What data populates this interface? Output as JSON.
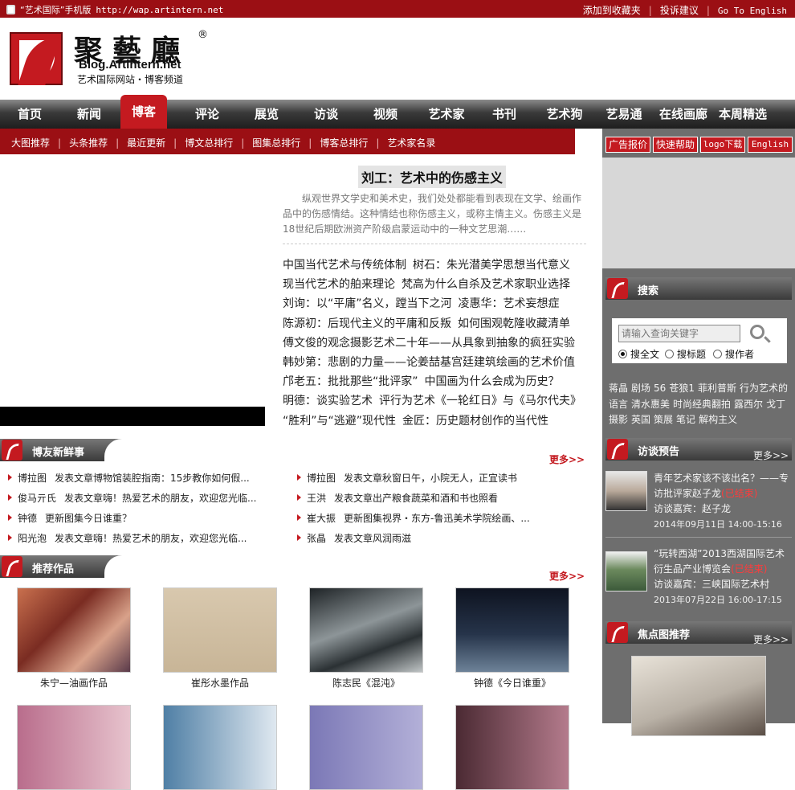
{
  "topbar": {
    "mobile_label": "“艺术国际”手机版",
    "mobile_url": "http://wap.artintern.net",
    "favorite": "添加到收藏夹",
    "feedback": "投诉建议",
    "english": "Go To English"
  },
  "logo": {
    "cn": "聚藝廳",
    "reg": "®",
    "url": "Blog.Artintern.net",
    "sub": "艺术国际网站・博客频道"
  },
  "nav": [
    "首页",
    "新闻",
    "博客",
    "评论",
    "展览",
    "访谈",
    "视频",
    "艺术家",
    "书刊",
    "艺术狗",
    "艺易通",
    "在线画廊",
    "本周精选"
  ],
  "nav_active": "博客",
  "subnav": [
    "大图推荐",
    "头条推荐",
    "最近更新",
    "博文总排行",
    "图集总排行",
    "博客总排行",
    "艺术家名录"
  ],
  "feature": {
    "title": "刘工：艺术中的伤感主义",
    "desc": "纵观世界文学史和美术史，我们处处都能看到表现在文学、绘画作品中的伤感情结。这种情结也称伤感主义，或称主情主义。伤感主义是18世纪后期欧洲资产阶级启蒙运动中的一种文艺思潮……"
  },
  "articles": [
    [
      "中国当代艺术与传统体制",
      "树石：朱光潜美学思想当代意义"
    ],
    [
      "现当代艺术的舶来理论",
      "梵高为什么自杀及艺术家职业选择"
    ],
    [
      "刘询：以“平庸”名义，蹚当下之河",
      "凌惠华：艺术妄想症"
    ],
    [
      "陈源初：后现代主义的平庸和反叛",
      "如何围观乾隆收藏清单"
    ],
    [
      "傅文俊的观念摄影艺术二十年——从具象到抽象的疯狂实验"
    ],
    [
      "韩妙第：悲剧的力量——论姜喆基宫廷建筑绘画的艺术价值"
    ],
    [
      "邝老五：批批那些“批评家”",
      "中国画为什么会成为历史？"
    ],
    [
      "明德：谈实验艺术",
      "评行为艺术《一轮红日》与《马尔代夫》"
    ],
    [
      "“胜利”与“逃避”现代性",
      "金匠：历史题材创作的当代性"
    ]
  ],
  "section_news": {
    "title": "博友新鲜事",
    "more": "更多>>",
    "items": [
      {
        "author": "博拉图",
        "text": "发表文章博物馆装腔指南：15步教你如何假..."
      },
      {
        "author": "博拉图",
        "text": "发表文章秋窗日午，小院无人，正宜读书"
      },
      {
        "author": "俊马亓氏",
        "text": "发表文章嗨！热爱艺术的朋友，欢迎您光临..."
      },
      {
        "author": "王洪",
        "text": "发表文章出产粮食蔬菜和酒和书也照看"
      },
      {
        "author": "钟德",
        "text": "更新图集今日谁重？"
      },
      {
        "author": "崔大振",
        "text": "更新图集视界・东方-鲁迅美术学院绘画、..."
      },
      {
        "author": "阳光泡",
        "text": "发表文章嗨！热爱艺术的朋友，欢迎您光临..."
      },
      {
        "author": "张晶",
        "text": "发表文章风润雨滋"
      }
    ]
  },
  "section_works": {
    "title": "推荐作品",
    "more": "更多>>",
    "items": [
      {
        "caption": "朱宁—油画作品",
        "color": "#a8523e"
      },
      {
        "caption": "崔彤水墨作品",
        "color": "#cdb79b"
      },
      {
        "caption": "陈志民《混沌》",
        "color": "#4b5357"
      },
      {
        "caption": "钟德《今日谁重》",
        "color": "#26303f"
      }
    ]
  },
  "sidebar": {
    "buttons": [
      "广告报价",
      "快速帮助",
      "logo下载",
      "English"
    ],
    "search": {
      "title": "搜索",
      "placeholder": "请输入查询关键字",
      "options": [
        "搜全文",
        "搜标题",
        "搜作者"
      ]
    },
    "tags": [
      "蒋晶",
      "剧场",
      "56",
      "苍狼1",
      "菲利普斯",
      "行为艺术的语言",
      "清水惠美",
      "时尚经典翻拍",
      "露西尔",
      "戈丁摄影",
      "英国",
      "策展",
      "笔记",
      "解构主义"
    ],
    "interviews": {
      "title": "访谈预告",
      "more": "更多>>",
      "items": [
        {
          "title": "青年艺术家该不该出名？——专访批评家赵子龙",
          "status": "(已结束)",
          "guest": "访谈嘉宾：赵子龙",
          "date": "2014年09月11日  14:00-15:16"
        },
        {
          "title": "“玩转西湖”2013西湖国际艺术衍生品产业博览会",
          "status": "(已结束)",
          "guest": "访谈嘉宾：三峡国际艺术村",
          "date": "2013年07月22日  16:00-17:15"
        }
      ]
    },
    "focus": {
      "title": "焦点图推荐",
      "more": "更多>>"
    }
  }
}
